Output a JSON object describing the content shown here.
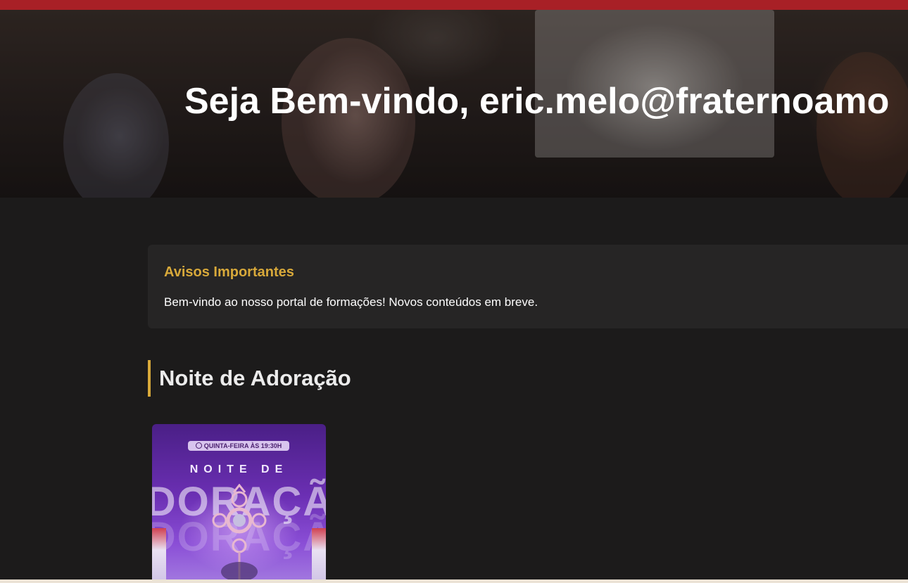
{
  "hero": {
    "welcome_title": "Seja Bem-vindo, eric.melo@fraternoamo"
  },
  "notice": {
    "title": "Avisos Importantes",
    "text": "Bem-vindo ao nosso portal de formações! Novos conteúdos em breve."
  },
  "section": {
    "title": "Noite de Adoração"
  },
  "card": {
    "poster_time": "QUINTA-FEIRA ÀS 19:30H",
    "poster_subtitle": "NOITE DE",
    "poster_title": "DORAÇÃ"
  },
  "colors": {
    "top_bar": "#a82026",
    "background": "#1c1b1b",
    "panel": "#262525",
    "accent_gold": "#d8a93a",
    "poster_purple": "#6b2fb3"
  }
}
